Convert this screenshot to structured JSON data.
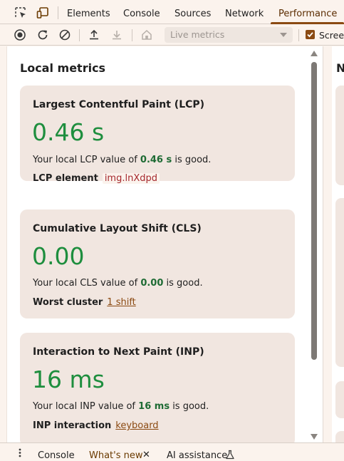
{
  "tabbar": {
    "tabs": [
      {
        "label": "Elements"
      },
      {
        "label": "Console"
      },
      {
        "label": "Sources"
      },
      {
        "label": "Network"
      },
      {
        "label": "Performance"
      }
    ],
    "active_tab": "Performance"
  },
  "toolbar": {
    "icons": [
      "record-icon",
      "reload-icon",
      "clear-icon",
      "upload-icon",
      "download-icon",
      "home-icon"
    ],
    "select": {
      "value": "Live metrics"
    },
    "checkbox": {
      "label": "Screenshots",
      "visible_label": "Screen",
      "checked": true
    }
  },
  "main": {
    "section_title": "Local metrics",
    "cards": [
      {
        "title": "Largest Contentful Paint (LCP)",
        "value": "0.46 s",
        "desc_prefix": "Your local LCP value of ",
        "desc_value": "0.46 s",
        "desc_suffix": " is good.",
        "row_label": "LCP element",
        "row_value": "img.lnXdpd"
      },
      {
        "title": "Cumulative Layout Shift (CLS)",
        "value": "0.00",
        "desc_prefix": "Your local CLS value of ",
        "desc_value": "0.00",
        "desc_suffix": " is good.",
        "row_label": "Worst cluster",
        "row_value": "1 shift"
      },
      {
        "title": "Interaction to Next Paint (INP)",
        "value": "16 ms",
        "desc_prefix": "Your local INP value of ",
        "desc_value": "16 ms",
        "desc_suffix": " is good.",
        "row_label": "INP interaction",
        "row_value": "keyboard"
      }
    ]
  },
  "right_panel": {
    "title_fragment": "N"
  },
  "drawer": {
    "tabs": [
      {
        "label": "Console"
      },
      {
        "label": "What's new"
      },
      {
        "label": "AI assistance"
      }
    ],
    "close_glyph": "✕"
  },
  "colors": {
    "good": "#1e8e3e",
    "accent": "#8b4a12",
    "card_bg": "#f1e6e0",
    "chrome_bg": "#fbf3ed"
  }
}
